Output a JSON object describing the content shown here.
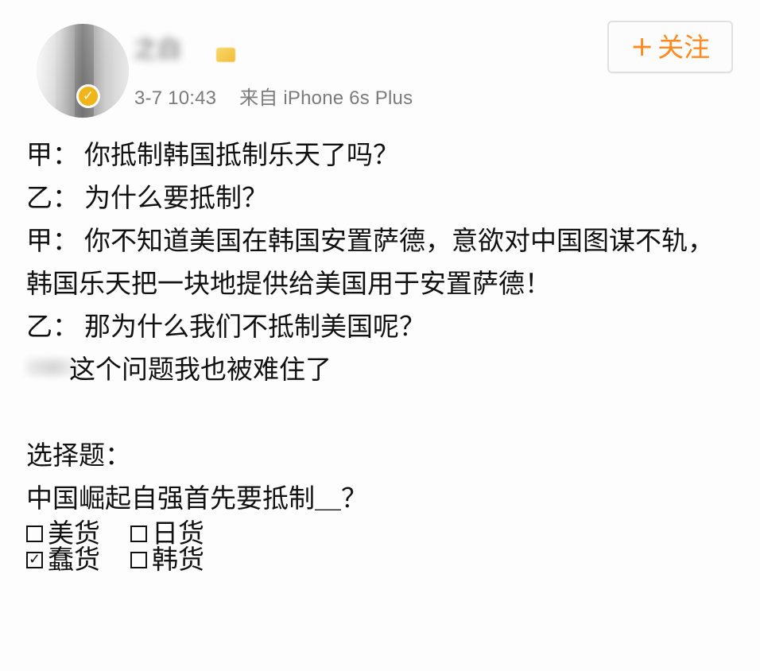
{
  "post": {
    "author": {
      "name": "之白",
      "verified": true,
      "avatar_icon": "user-avatar",
      "badge_icon": "verified-badge-icon",
      "name_suffix_icon": "vip-badge-icon"
    },
    "meta": {
      "timestamp": "3-7 10:43",
      "source": "来自 iPhone 6s Plus"
    },
    "follow_button": {
      "plus": "+",
      "label": "关注"
    },
    "content": {
      "line_1": {
        "speaker": "甲：",
        "text": "你抵制韩国抵制乐天了吗？"
      },
      "line_2": {
        "speaker": "乙：",
        "text": "为什么要抵制？"
      },
      "line_3": {
        "speaker": "甲：",
        "text": "你不知道美国在韩国安置萨德，意欲对中国图谋不轨，韩国乐天把一块地提供给美国用于安置萨德！"
      },
      "line_4": {
        "speaker": "乙：",
        "text": "那为什么我们不抵制美国呢？"
      },
      "line_5": "这个问题我也被难住了",
      "question_title": "选择题：",
      "question_text": "中国崛起自强首先要抵制＿？",
      "options": [
        {
          "label": "美货",
          "checked": false
        },
        {
          "label": "日货",
          "checked": false
        },
        {
          "label": "蠢货",
          "checked": true
        },
        {
          "label": "韩货",
          "checked": false
        }
      ]
    },
    "colors": {
      "follow_text": "#ff8a1f",
      "meta_text": "#7b7b7b",
      "body_text": "#111111",
      "badge": "#f1b51c"
    }
  }
}
